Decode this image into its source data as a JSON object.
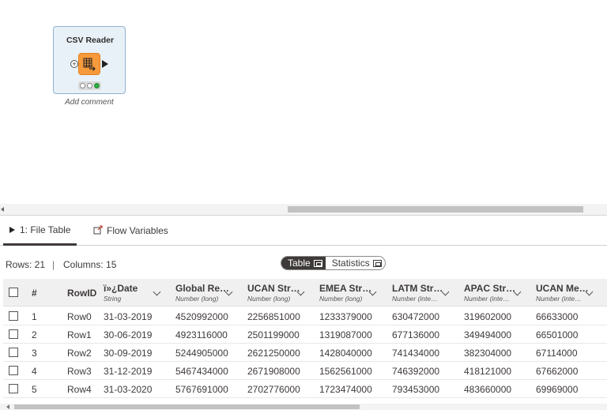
{
  "canvas": {
    "node": {
      "title": "CSV Reader",
      "icon": "csv-table-icon",
      "accent_color": "#f79a3b",
      "status": "executed",
      "status_color": "#2fb043",
      "comment_placeholder": "Add comment"
    }
  },
  "panel": {
    "tabs": [
      {
        "label": "1: File Table",
        "icon": "play-icon",
        "active": true
      },
      {
        "label": "Flow Variables",
        "icon": "flow-variable-icon",
        "active": false
      }
    ],
    "info": {
      "rows": "Rows: 21",
      "separator": "|",
      "columns": "Columns: 15"
    },
    "view_toggle": {
      "options": [
        "Table",
        "Statistics"
      ],
      "selected": "Table"
    }
  },
  "table": {
    "columns": [
      {
        "name": "#",
        "type": ""
      },
      {
        "name": "RowID",
        "type": ""
      },
      {
        "name": "ï»¿Date",
        "type": "String"
      },
      {
        "name": "Global Re…",
        "type": "Number (long)"
      },
      {
        "name": "UCAN Str…",
        "type": "Number (long)"
      },
      {
        "name": "EMEA Str…",
        "type": "Number (long)"
      },
      {
        "name": "LATM Str…",
        "type": "Number (inte…"
      },
      {
        "name": "APAC Str…",
        "type": "Number (inte…"
      },
      {
        "name": "UCAN Me…",
        "type": "Number (inte…"
      }
    ],
    "rows": [
      [
        "1",
        "Row0",
        "31-03-2019",
        "4520992000",
        "2256851000",
        "1233379000",
        "630472000",
        "319602000",
        "66633000"
      ],
      [
        "2",
        "Row1",
        "30-06-2019",
        "4923116000",
        "2501199000",
        "1319087000",
        "677136000",
        "349494000",
        "66501000"
      ],
      [
        "3",
        "Row2",
        "30-09-2019",
        "5244905000",
        "2621250000",
        "1428040000",
        "741434000",
        "382304000",
        "67114000"
      ],
      [
        "4",
        "Row3",
        "31-12-2019",
        "5467434000",
        "2671908000",
        "1562561000",
        "746392000",
        "418121000",
        "67662000"
      ],
      [
        "5",
        "Row4",
        "31-03-2020",
        "5767691000",
        "2702776000",
        "1723474000",
        "793453000",
        "483660000",
        "69969000"
      ]
    ]
  }
}
